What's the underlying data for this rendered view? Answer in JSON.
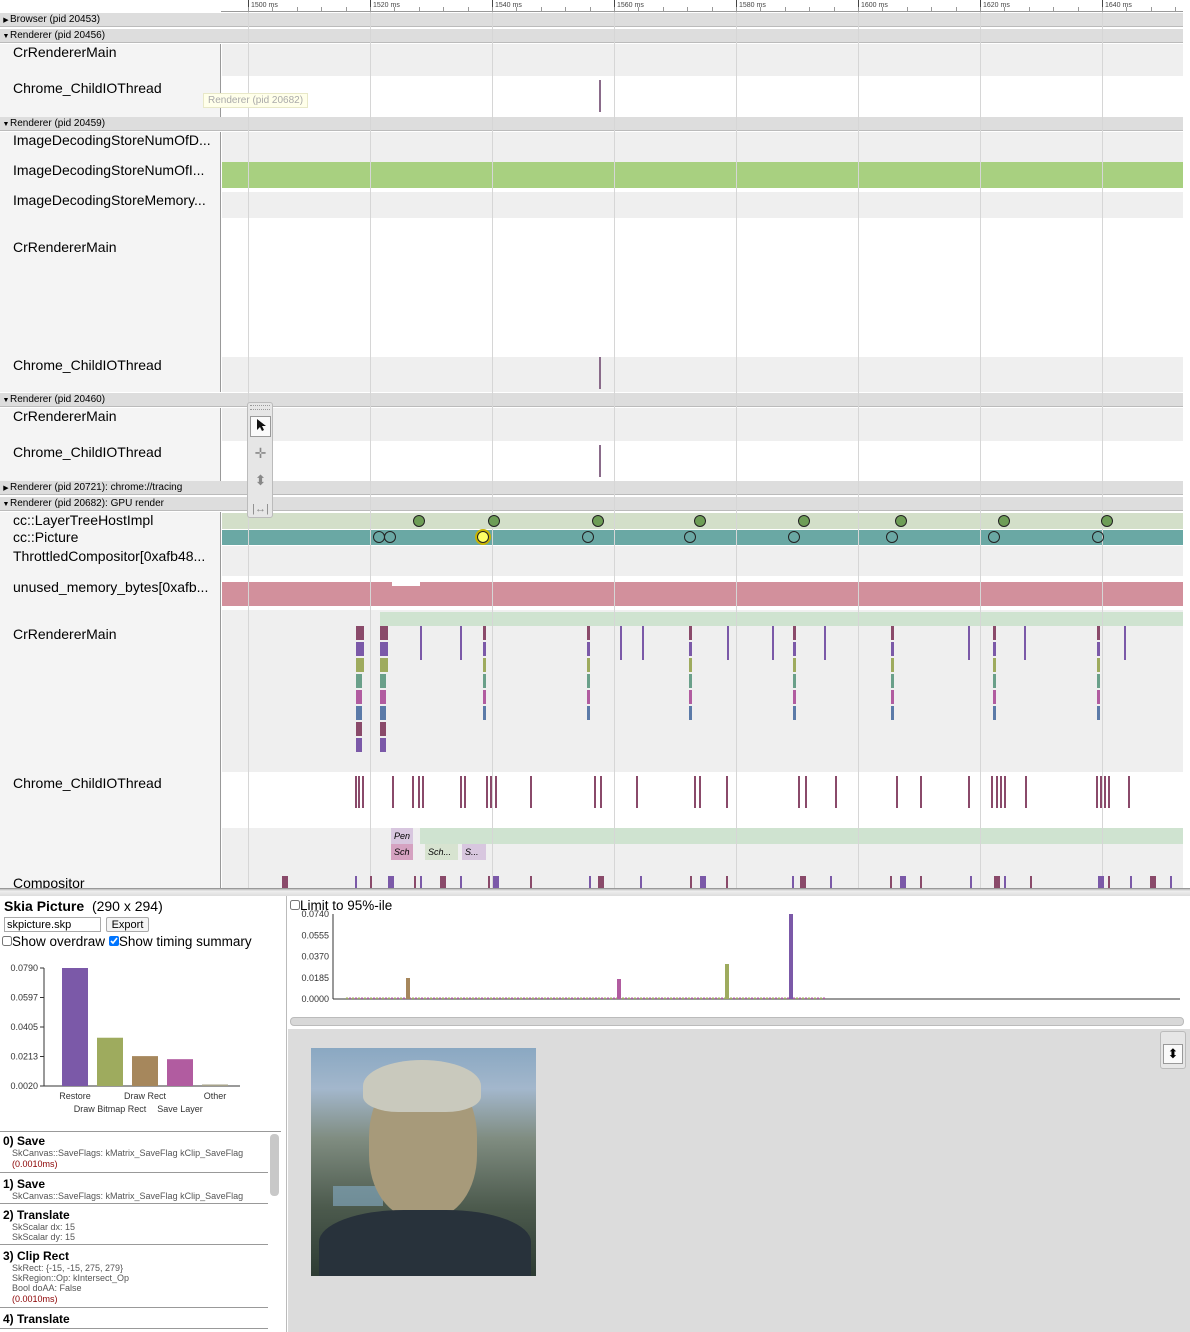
{
  "ruler": {
    "ticks": [
      "1500 ms",
      "1520 ms",
      "1540 ms",
      "1560 ms",
      "1580 ms",
      "1600 ms",
      "1620 ms",
      "1640 ms"
    ]
  },
  "tooltip": "Renderer (pid 20682)",
  "processes": [
    {
      "title": "Browser (pid 20453)",
      "expanded": false
    },
    {
      "title": "Renderer (pid 20456)",
      "expanded": true,
      "threads": [
        "CrRendererMain",
        "Chrome_ChildIOThread"
      ]
    },
    {
      "title": "Renderer (pid 20459)",
      "expanded": true,
      "threads": [
        "ImageDecodingStoreNumOfD...",
        "ImageDecodingStoreNumOfI...",
        "ImageDecodingStoreMemory...",
        "CrRendererMain",
        "Chrome_ChildIOThread"
      ]
    },
    {
      "title": "Renderer (pid 20460)",
      "expanded": true,
      "threads": [
        "CrRendererMain",
        "Chrome_ChildIOThread"
      ]
    },
    {
      "title": "Renderer (pid 20721): chrome://tracing",
      "expanded": false
    },
    {
      "title": "Renderer (pid 20682): GPU render",
      "expanded": true,
      "threads": [
        "cc::LayerTreeHostImpl",
        "cc::Picture",
        "ThrottledCompositor[0xafb48...",
        "unused_memory_bytes[0xafb...",
        "CrRendererMain",
        "Chrome_ChildIOThread",
        "Compositor"
      ]
    }
  ],
  "slices": {
    "pen": "Pen",
    "sch": "Sch",
    "sch2": "Sch...",
    "s": "S..."
  },
  "tools": {
    "select": "arrow-cursor",
    "pan": "pan",
    "zoom": "zoom",
    "timing": "timing"
  },
  "skia": {
    "title": "Skia Picture",
    "size": "(290 x 294)",
    "filename": "skpicture.skp",
    "export": "Export",
    "show_overdraw": "Show overdraw",
    "show_overdraw_checked": false,
    "show_timing": "Show timing summary",
    "show_timing_checked": true,
    "limit": "Limit to 95%-ile",
    "limit_checked": false,
    "summary_chart": {
      "type": "bar",
      "yticks": [
        "0.0790",
        "0.0597",
        "0.0405",
        "0.0213",
        "0.0020"
      ],
      "categories": [
        "Restore",
        "Draw Bitmap Rect",
        "Draw Rect",
        "Save Layer",
        "Other"
      ],
      "values": [
        0.079,
        0.0335,
        0.0215,
        0.0195,
        0.0025
      ],
      "colors": [
        "#7b59a8",
        "#9eab5e",
        "#a6875c",
        "#b15ca0",
        "#a6a28a"
      ]
    },
    "timeline_chart": {
      "type": "bar",
      "yticks": [
        "0.0740",
        "0.0555",
        "0.0370",
        "0.0185",
        "0.0000"
      ]
    },
    "commands": [
      {
        "title": "0) Save",
        "lines": [
          "SkCanvas::SaveFlags: kMatrix_SaveFlag kClip_SaveFlag"
        ],
        "time": "(0.0010ms)"
      },
      {
        "title": "1) Save",
        "lines": [
          "SkCanvas::SaveFlags: kMatrix_SaveFlag kClip_SaveFlag"
        ],
        "time": ""
      },
      {
        "title": "2) Translate",
        "lines": [
          "SkScalar dx: 15",
          "SkScalar dy: 15"
        ],
        "time": ""
      },
      {
        "title": "3) Clip Rect",
        "lines": [
          "SkRect: {-15, -15, 275, 279}",
          "SkRegion::Op: kIntersect_Op",
          "Bool doAA: False"
        ],
        "time": "(0.0010ms)"
      },
      {
        "title": "4) Translate",
        "lines": [],
        "time": ""
      }
    ]
  }
}
